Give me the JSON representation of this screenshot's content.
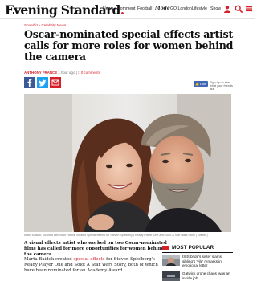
{
  "header": {
    "logo_main": "Evening Standard",
    "logo_dot": ".",
    "nav": [
      "News",
      "Comment",
      "Football",
      "Mode",
      "GO London",
      "Lifestyle",
      "Show"
    ],
    "icons": [
      "user-icon",
      "search-icon",
      "menu-icon"
    ]
  },
  "article": {
    "kicker": "Showbiz › Celebrity News",
    "headline": "Oscar-nominated special effects artist calls for more roles for women behind the camera",
    "author": "ANTHONY FRANCE",
    "time": "1 hour ago",
    "comments": "0 comments",
    "share_icons": [
      "facebook-icon",
      "twitter-icon",
      "email-icon"
    ],
    "fb_like_label": "Like",
    "fb_like_text": "Sign Up to see what your friends like.",
    "caption": "Marta Baidek, pictured with Mark Hamill, created special effects for Steven Spielberg's Ready Player One and Solo: A Star Wars Story ( Twitter )",
    "standfirst": "A visual effects artist who worked on two Oscar-nominated films has called for more opportunities for women behind the camera.",
    "body_start": "Marta Baidek created ",
    "body_link": "special effects",
    "body_end": " for Steven Spielberg's Ready Player One and Solo: A Star Wars Story, both of which have been nominated for an Academy Award."
  },
  "most_popular": {
    "title": "MOST POPULAR",
    "items": [
      {
        "text": "ISIS bride's sister slams sibling's 'vile' remarks in emotional letter"
      },
      {
        "text": "Gatwick drone chaos 'was an inside job'"
      }
    ]
  },
  "colors": {
    "accent": "#d5202a",
    "facebook": "#3b5998",
    "twitter": "#1da1f2"
  }
}
